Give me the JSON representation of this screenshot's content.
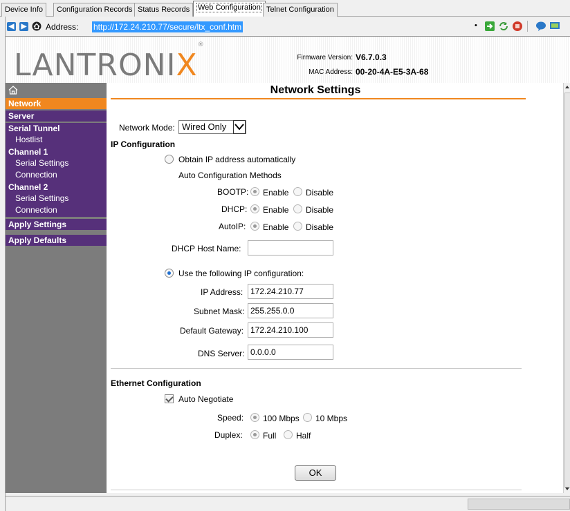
{
  "tabs": [
    {
      "label": "Device Info"
    },
    {
      "label": "Configuration Records"
    },
    {
      "label": "Status Records"
    },
    {
      "label": "Web Configuration",
      "active": true
    },
    {
      "label": "Telnet Configuration"
    }
  ],
  "address_bar": {
    "label": "Address:",
    "url": "http://172.24.210.77/secure/ltx_conf.htm"
  },
  "header": {
    "logo_text": "LANTRONIX",
    "firmware_label": "Firmware Version:",
    "firmware_value": "V6.7.0.3",
    "mac_label": "MAC Address:",
    "mac_value": "00-20-4A-E5-3A-68"
  },
  "sidebar": {
    "items": [
      {
        "label": "Network",
        "active": true
      },
      {
        "label": "Server"
      },
      {
        "label": "Serial Tunnel"
      },
      {
        "label": "Hostlist"
      },
      {
        "label": "Channel 1"
      },
      {
        "label": "Serial Settings"
      },
      {
        "label": "Connection"
      },
      {
        "label": "Channel 2"
      },
      {
        "label": "Serial Settings"
      },
      {
        "label": "Connection"
      },
      {
        "label": "Apply Settings"
      },
      {
        "label": "Apply Defaults"
      }
    ]
  },
  "main": {
    "title": "Network Settings",
    "network_mode_label": "Network Mode:",
    "network_mode_value": "Wired Only",
    "ip_config_heading": "IP Configuration",
    "obtain_auto_label": "Obtain IP address automatically",
    "auto_methods_label": "Auto Configuration Methods",
    "bootp_label": "BOOTP:",
    "dhcp_label": "DHCP:",
    "autoip_label": "AutoIP:",
    "enable_label": "Enable",
    "disable_label": "Disable",
    "dhcp_host_label": "DHCP Host Name:",
    "dhcp_host_value": "",
    "use_following_label": "Use the following IP configuration:",
    "ip_address_label": "IP Address:",
    "ip_address_value": "172.24.210.77",
    "subnet_mask_label": "Subnet Mask:",
    "subnet_mask_value": "255.255.0.0",
    "gateway_label": "Default Gateway:",
    "gateway_value": "172.24.210.100",
    "dns_label": "DNS Server:",
    "dns_value": "0.0.0.0",
    "ethernet_heading": "Ethernet Configuration",
    "auto_negotiate_label": "Auto Negotiate",
    "speed_label": "Speed:",
    "speed_100_label": "100 Mbps",
    "speed_10_label": "10 Mbps",
    "duplex_label": "Duplex:",
    "full_label": "Full",
    "half_label": "Half",
    "ok_label": "OK"
  },
  "colors": {
    "accent_orange": "#f0871f",
    "sidebar_purple": "#56307a",
    "sidebar_grey": "#7c7c7c"
  }
}
